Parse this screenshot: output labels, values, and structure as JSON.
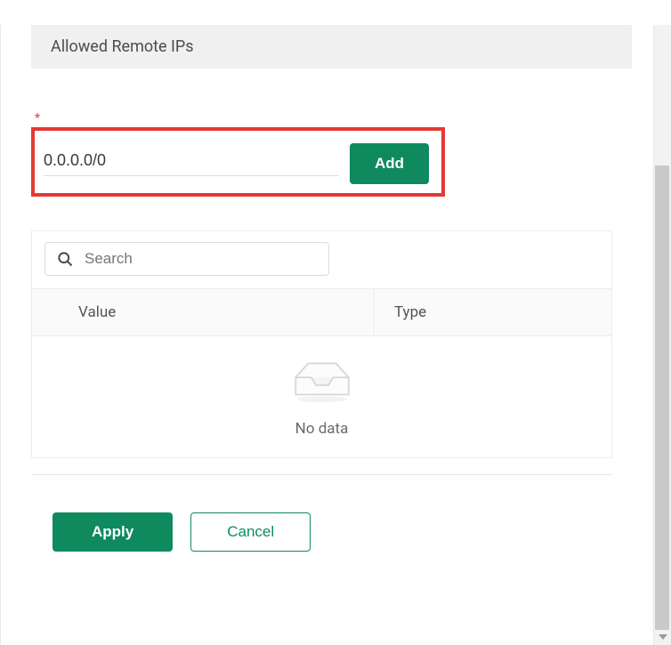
{
  "section": {
    "title": "Allowed Remote IPs",
    "required_marker": "*"
  },
  "ip_entry": {
    "value": "0.0.0.0/0",
    "add_label": "Add"
  },
  "search": {
    "placeholder": "Search"
  },
  "table": {
    "columns": {
      "value": "Value",
      "type": "Type"
    },
    "empty_label": "No data",
    "rows": []
  },
  "actions": {
    "apply_label": "Apply",
    "cancel_label": "Cancel"
  }
}
